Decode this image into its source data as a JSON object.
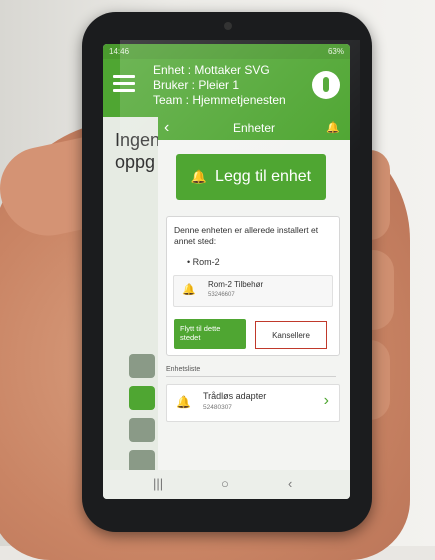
{
  "status_bar": {
    "time": "14:46",
    "right": "63%"
  },
  "app_bar": {
    "unit_line": "Enhet : Mottaker SVG",
    "user_line": "Bruker : Pleier 1",
    "team_line": "Team : Hjemmetjenesten"
  },
  "background": {
    "text_line1": "Ingen",
    "text_line2": "oppg"
  },
  "panel": {
    "title": "Enheter",
    "add_button_label": "Legg til enhet",
    "notice": {
      "message": "Denne enheten er allerede installert et annet sted:",
      "location": "• Rom-2",
      "device_name": "Rom-2 Tilbehør",
      "device_id": "53246607",
      "move_label": "Flytt til dette stedet",
      "cancel_label": "Kansellere"
    },
    "list_label": "Enhetsliste",
    "list_items": [
      {
        "name": "Trådløs adapter",
        "id": "52480307"
      }
    ]
  },
  "colors": {
    "accent": "#4fa632",
    "cancel_border": "#c0392b"
  },
  "icons": [
    "menu-icon",
    "app-logo-icon",
    "back-arrow-icon",
    "add-bell-icon",
    "bell-icon",
    "chevron-right-icon"
  ]
}
